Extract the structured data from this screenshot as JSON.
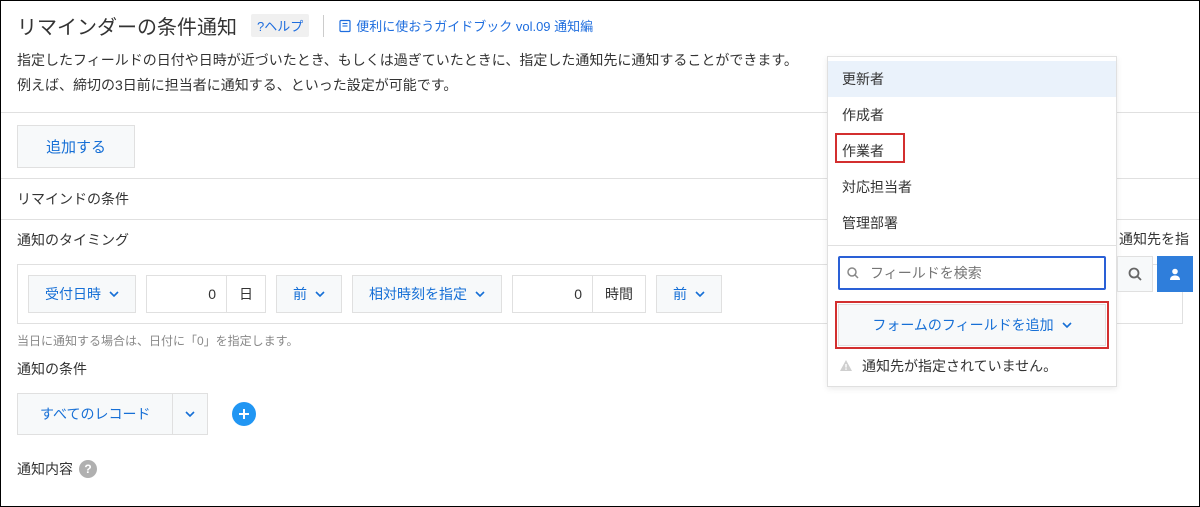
{
  "header": {
    "title": "リマインダーの条件通知",
    "help_label": "?ヘルプ",
    "guidebook_label": "便利に使おうガイドブック vol.09 通知編"
  },
  "description": {
    "line1": "指定したフィールドの日付や日時が近づいたとき、もしくは過ぎていたときに、指定した通知先に通知することができます。",
    "line2": "例えば、締切の3日前に担当者に通知する、といった設定が可能です。"
  },
  "add_button_label": "追加する",
  "conditions_header": "リマインドの条件",
  "timing": {
    "label": "通知のタイミング",
    "controls": {
      "field_select": "受付日時",
      "day_value": "0",
      "day_unit": "日",
      "day_mode": "前",
      "relative_time": "相対時刻を指定",
      "hour_value": "0",
      "hour_unit": "時間",
      "hour_mode": "前"
    },
    "hint": "当日に通知する場合は、日付に「0」を指定します。"
  },
  "condition": {
    "label": "通知の条件",
    "scope_select": "すべてのレコード"
  },
  "content": {
    "label": "通知内容"
  },
  "right": {
    "context_text": "で、通知先を指",
    "dropdown_items": [
      "更新者",
      "作成者",
      "作業者",
      "対応担当者",
      "管理部署"
    ],
    "search_placeholder": "フィールドを検索",
    "add_field_button": "フォームのフィールドを追加",
    "warning_text": "通知先が指定されていません。"
  }
}
